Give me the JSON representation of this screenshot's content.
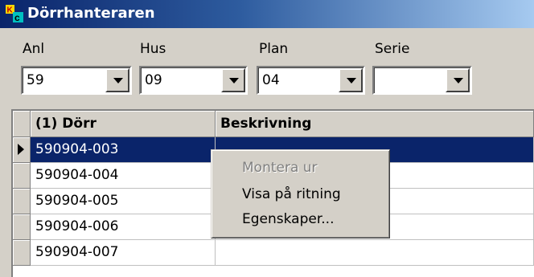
{
  "window": {
    "title": "Dörrhanteraren",
    "icon": "kc-app-icon"
  },
  "filters": [
    {
      "label": "Anl",
      "value": "59"
    },
    {
      "label": "Hus",
      "value": "09"
    },
    {
      "label": "Plan",
      "value": "04"
    },
    {
      "label": "Serie",
      "value": ""
    }
  ],
  "grid": {
    "columns": [
      "(1) Dörr",
      "Beskrivning"
    ],
    "rows": [
      {
        "door": "590904-003",
        "description": "",
        "selected": true
      },
      {
        "door": "590904-004",
        "description": ""
      },
      {
        "door": "590904-005",
        "description": ""
      },
      {
        "door": "590904-006",
        "description": ""
      },
      {
        "door": "590904-007",
        "description": ""
      }
    ]
  },
  "context_menu": {
    "items": [
      {
        "label": "Montera ur",
        "enabled": false
      },
      {
        "label": "Visa på ritning",
        "enabled": true
      },
      {
        "label": "Egenskaper...",
        "enabled": true
      }
    ]
  },
  "colors": {
    "titlebar_start": "#0a246a",
    "titlebar_end": "#a6caf0",
    "selection": "#0a246a",
    "face": "#d4d0c8"
  }
}
